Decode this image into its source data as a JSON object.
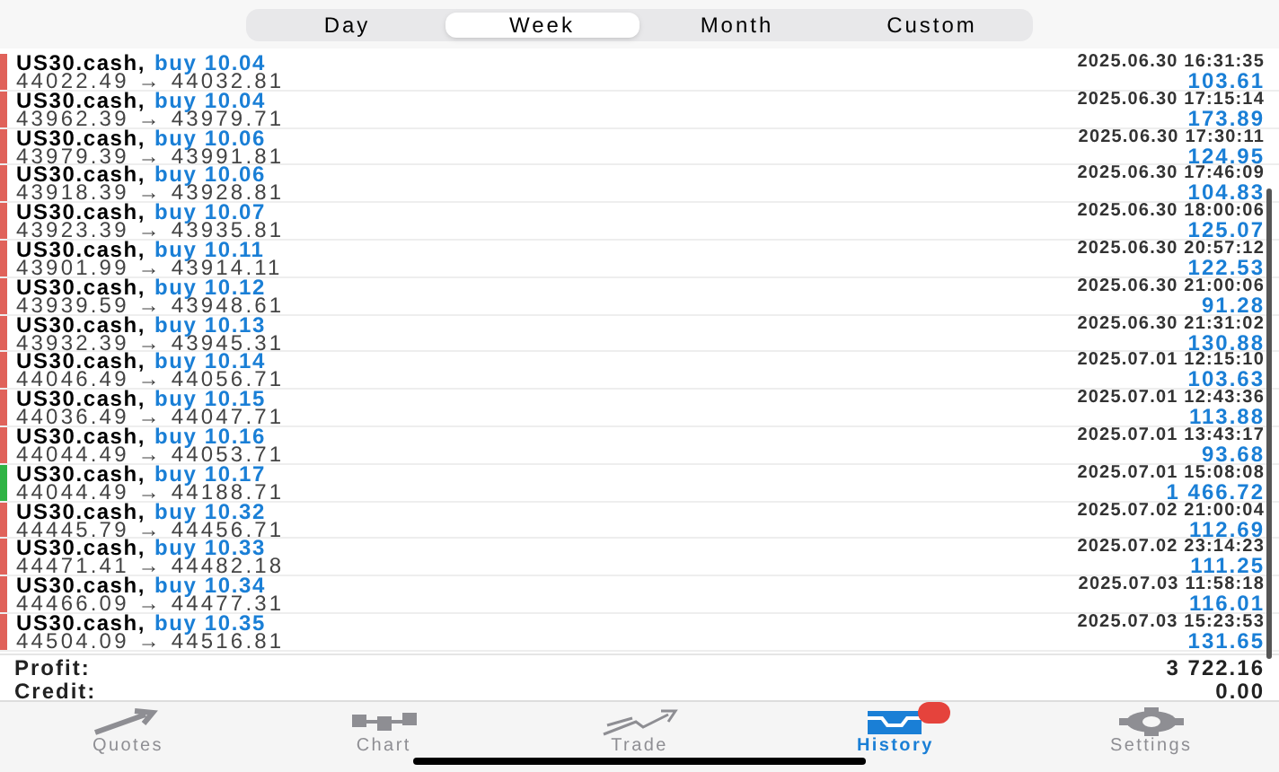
{
  "period_tabs": [
    {
      "label": "Day",
      "selected": false
    },
    {
      "label": "Week",
      "selected": true
    },
    {
      "label": "Month",
      "selected": false
    },
    {
      "label": "Custom",
      "selected": false
    }
  ],
  "trades": [
    {
      "symbol": "US30.cash,",
      "deal": "buy 10.04",
      "time": "2025.06.30 16:31:35",
      "prices": "44022.49 → 44032.81",
      "profit": "103.61",
      "color": "#e0625a"
    },
    {
      "symbol": "US30.cash,",
      "deal": "buy 10.04",
      "time": "2025.06.30 17:15:14",
      "prices": "43962.39 → 43979.71",
      "profit": "173.89",
      "color": "#e0625a"
    },
    {
      "symbol": "US30.cash,",
      "deal": "buy 10.06",
      "time": "2025.06.30 17:30:11",
      "prices": "43979.39 → 43991.81",
      "profit": "124.95",
      "color": "#e0625a"
    },
    {
      "symbol": "US30.cash,",
      "deal": "buy 10.06",
      "time": "2025.06.30 17:46:09",
      "prices": "43918.39 → 43928.81",
      "profit": "104.83",
      "color": "#e0625a"
    },
    {
      "symbol": "US30.cash,",
      "deal": "buy 10.07",
      "time": "2025.06.30 18:00:06",
      "prices": "43923.39 → 43935.81",
      "profit": "125.07",
      "color": "#e0625a"
    },
    {
      "symbol": "US30.cash,",
      "deal": "buy 10.11",
      "time": "2025.06.30 20:57:12",
      "prices": "43901.99 → 43914.11",
      "profit": "122.53",
      "color": "#e0625a"
    },
    {
      "symbol": "US30.cash,",
      "deal": "buy 10.12",
      "time": "2025.06.30 21:00:06",
      "prices": "43939.59 → 43948.61",
      "profit": "91.28",
      "color": "#e0625a"
    },
    {
      "symbol": "US30.cash,",
      "deal": "buy 10.13",
      "time": "2025.06.30 21:31:02",
      "prices": "43932.39 → 43945.31",
      "profit": "130.88",
      "color": "#e0625a"
    },
    {
      "symbol": "US30.cash,",
      "deal": "buy 10.14",
      "time": "2025.07.01 12:15:10",
      "prices": "44046.49 → 44056.71",
      "profit": "103.63",
      "color": "#e0625a"
    },
    {
      "symbol": "US30.cash,",
      "deal": "buy 10.15",
      "time": "2025.07.01 12:43:36",
      "prices": "44036.49 → 44047.71",
      "profit": "113.88",
      "color": "#e0625a"
    },
    {
      "symbol": "US30.cash,",
      "deal": "buy 10.16",
      "time": "2025.07.01 13:43:17",
      "prices": "44044.49 → 44053.71",
      "profit": "93.68",
      "color": "#e0625a"
    },
    {
      "symbol": "US30.cash,",
      "deal": "buy 10.17",
      "time": "2025.07.01 15:08:08",
      "prices": "44044.49 → 44188.71",
      "profit": "1 466.72",
      "color": "#2fb344"
    },
    {
      "symbol": "US30.cash,",
      "deal": "buy 10.32",
      "time": "2025.07.02 21:00:04",
      "prices": "44445.79 → 44456.71",
      "profit": "112.69",
      "color": "#e0625a"
    },
    {
      "symbol": "US30.cash,",
      "deal": "buy 10.33",
      "time": "2025.07.02 23:14:23",
      "prices": "44471.41 → 44482.18",
      "profit": "111.25",
      "color": "#e0625a"
    },
    {
      "symbol": "US30.cash,",
      "deal": "buy 10.34",
      "time": "2025.07.03 11:58:18",
      "prices": "44466.09 → 44477.31",
      "profit": "116.01",
      "color": "#e0625a"
    },
    {
      "symbol": "US30.cash,",
      "deal": "buy 10.35",
      "time": "2025.07.03 15:23:53",
      "prices": "44504.09 → 44516.81",
      "profit": "131.65",
      "color": "#e0625a"
    }
  ],
  "summary": [
    {
      "label": "Profit:",
      "value": "3 722.16"
    },
    {
      "label": "Credit:",
      "value": "0.00"
    }
  ],
  "tab_bar": [
    {
      "label": "Quotes",
      "kind": "quotes",
      "selected": false
    },
    {
      "label": "Chart",
      "kind": "chart",
      "selected": false
    },
    {
      "label": "Trade",
      "kind": "trade",
      "selected": false
    },
    {
      "label": "History",
      "kind": "history",
      "selected": true
    },
    {
      "label": "Settings",
      "kind": "settings",
      "selected": false
    }
  ]
}
